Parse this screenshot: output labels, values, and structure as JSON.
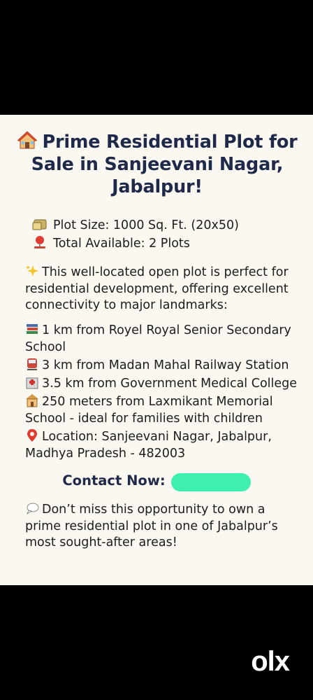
{
  "title": "Prime Residential Plot for Sale in Sanjeevani Nagar, Jabalpur!",
  "specs": {
    "plot_size": "Plot Size: 1000 Sq. Ft. (20x50)",
    "total_available": "Total Available: 2 Plots"
  },
  "intro": "This well-located open plot is perfect for residential development, offering excellent connectivity to major landmarks:",
  "landmarks": [
    "1 km from Royel Royal Senior Secondary School",
    "3 km from Madan Mahal Railway Station",
    "3.5 km from Government Medical College",
    "250 meters from Laxmikant Memorial School - ideal for families with children"
  ],
  "location": "Location: Sanjeevani Nagar, Jabalpur, Madhya Pradesh - 482003",
  "contact_label": "Contact Now:",
  "closing": "Don’t miss this opportunity to own a prime residential plot in one of Jabalpur’s most sought-after areas!",
  "watermark": "olx",
  "colors": {
    "title": "#1f2a4a",
    "redaction": "#3ef0b0",
    "card_bg": "#fbf8f2"
  },
  "icons": [
    "house-icon",
    "money-icon",
    "pin-icon",
    "sparkles-icon",
    "books-icon",
    "train-icon",
    "hospital-icon",
    "school-icon",
    "location-pin-icon",
    "speech-bubble-icon"
  ]
}
